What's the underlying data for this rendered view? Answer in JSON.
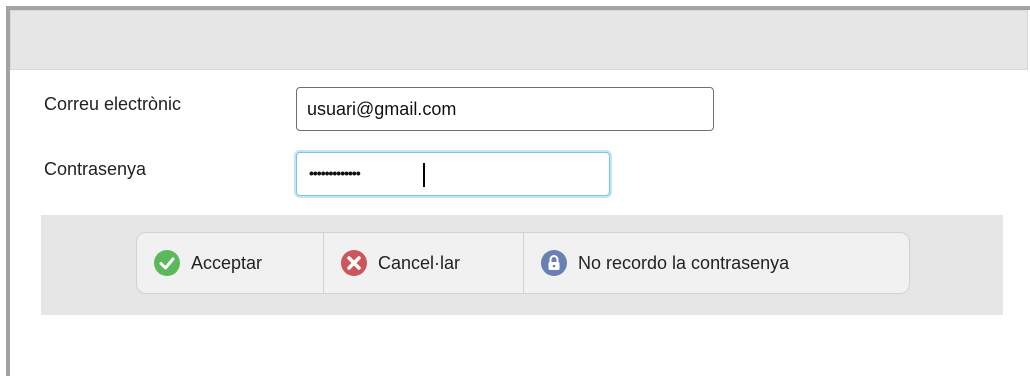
{
  "form": {
    "email_label": "Correu electrònic",
    "email_value": "usuari@gmail.com",
    "password_label": "Contrasenya",
    "password_mask": "•••••••••••••"
  },
  "actions": {
    "accept_label": "Acceptar",
    "accept_icon": "check-circle-icon",
    "cancel_label": "Cancel·lar",
    "cancel_icon": "x-circle-icon",
    "forgot_label": "No recordo la contrasenya",
    "forgot_icon": "lock-icon"
  },
  "colors": {
    "accept_green": "#5cb85c",
    "cancel_red": "#c9575b",
    "lock_blue": "#6a7fb3",
    "focus_border": "#7ac6e6"
  }
}
